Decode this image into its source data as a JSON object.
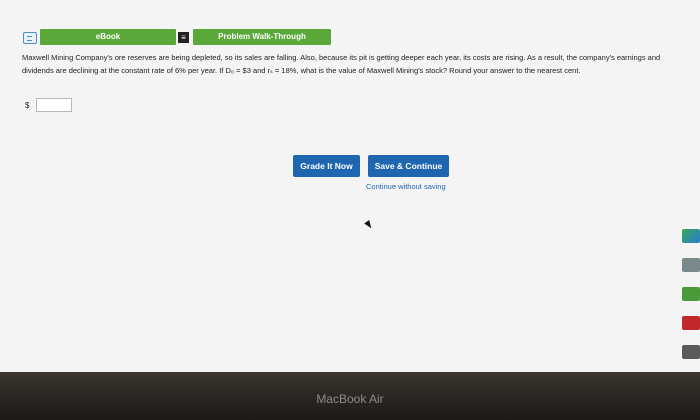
{
  "toolbar": {
    "ebook_label": "eBook",
    "walkthrough_label": "Problem Walk-Through"
  },
  "question": {
    "text": "Maxwell Mining Company's ore reserves are being depleted, so its sales are falling. Also, because its pit is getting deeper each year, its costs are rising. As a result, the company's earnings and dividends are declining at the constant rate of 6% per year. If D₀ = $3 and rₛ = 18%, what is the value of Maxwell Mining's stock? Round your answer to the nearest cent."
  },
  "answer": {
    "currency_symbol": "$",
    "value": ""
  },
  "actions": {
    "grade_label": "Grade It Now",
    "save_label": "Save & Continue",
    "continue_label": "Continue without saving"
  },
  "device": {
    "brand": "MacBook Air"
  },
  "colors": {
    "toolbar_green": "#5aa83a",
    "action_blue": "#1f66b1"
  },
  "icons": [
    "ebook-icon",
    "walkthrough-icon",
    "cursor-icon"
  ]
}
